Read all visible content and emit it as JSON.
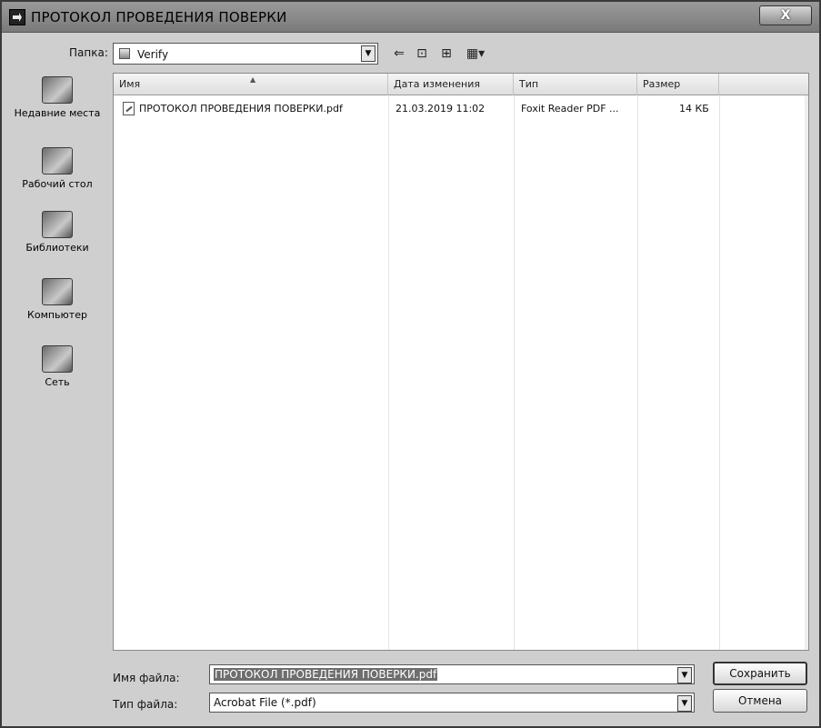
{
  "window": {
    "title": "ПРОТОКОЛ ПРОВЕДЕНИЯ ПОВЕРКИ",
    "close_label": "X"
  },
  "toolbar": {
    "folder_label": "Папка:",
    "folder_value": "Verify",
    "back_icon": "back-arrow-icon",
    "up_icon": "up-folder-icon",
    "new_folder_icon": "new-folder-icon",
    "view_icon": "view-menu-icon"
  },
  "places": [
    {
      "label": "Недавние места",
      "icon": "recent-places-icon"
    },
    {
      "label": "Рабочий стол",
      "icon": "desktop-icon"
    },
    {
      "label": "Библиотеки",
      "icon": "libraries-icon"
    },
    {
      "label": "Компьютер",
      "icon": "computer-icon"
    },
    {
      "label": "Сеть",
      "icon": "network-icon"
    }
  ],
  "file_list": {
    "columns": [
      "Имя",
      "Дата изменения",
      "Тип",
      "Размер"
    ],
    "rows": [
      {
        "name": "ПРОТОКОЛ ПРОВЕДЕНИЯ ПОВЕРКИ.pdf",
        "modified": "21.03.2019 11:02",
        "type": "Foxit Reader PDF ...",
        "size": "14 КБ"
      }
    ]
  },
  "bottom": {
    "filename_label": "Имя файла:",
    "filename_value": "ПРОТОКОЛ ПРОВЕДЕНИЯ ПОВЕРКИ.pdf",
    "filetype_label": "Тип файла:",
    "filetype_value": "Acrobat File (*.pdf)",
    "save_label": "Сохранить",
    "cancel_label": "Отмена"
  }
}
